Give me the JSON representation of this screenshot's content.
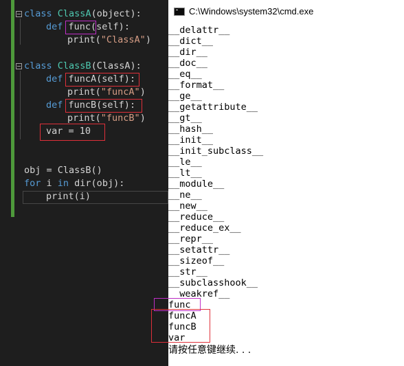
{
  "editor": {
    "code": {
      "l1": {
        "kw": "class",
        "name": "ClassA",
        "rest": "(object):"
      },
      "l2": {
        "kw": "def",
        "name": "func",
        "rest": "(self):"
      },
      "l3": {
        "call": "print(",
        "str": "\"ClassA\"",
        "end": ")"
      },
      "l5": {
        "kw": "class",
        "name": "ClassB",
        "rest": "(ClassA):"
      },
      "l6": {
        "kw": "def",
        "name": "funcA",
        "rest": "(self):"
      },
      "l7": {
        "call": "print(",
        "str": "\"funcA\"",
        "end": ")"
      },
      "l8": {
        "kw": "def",
        "name": "funcB",
        "rest": "(self):"
      },
      "l9": {
        "call": "print(",
        "str": "\"funcB\"",
        "end": ")"
      },
      "l10": "var = 10",
      "l13": "obj = ClassB()",
      "l14": {
        "kw": "for",
        "mid": " i ",
        "kw2": "in",
        "rest": " dir(obj):"
      },
      "l15": "print(i)"
    }
  },
  "console": {
    "title": "C:\\Windows\\system32\\cmd.exe",
    "lines": [
      "__delattr__",
      "__dict__",
      "__dir__",
      "__doc__",
      "__eq__",
      "__format__",
      "__ge__",
      "__getattribute__",
      "__gt__",
      "__hash__",
      "__init__",
      "__init_subclass__",
      "__le__",
      "__lt__",
      "__module__",
      "__ne__",
      "__new__",
      "__reduce__",
      "__reduce_ex__",
      "__repr__",
      "__setattr__",
      "__sizeof__",
      "__str__",
      "__subclasshook__",
      "__weakref__",
      "func",
      "funcA",
      "funcB",
      "var"
    ],
    "pause_text": "请按任意键继续. . ."
  },
  "colors": {
    "highlight_red": "#e0303a",
    "highlight_magenta": "#c02ec8",
    "keyword": "#569cd6",
    "classname": "#4ec9b0",
    "string": "#d69d85"
  }
}
